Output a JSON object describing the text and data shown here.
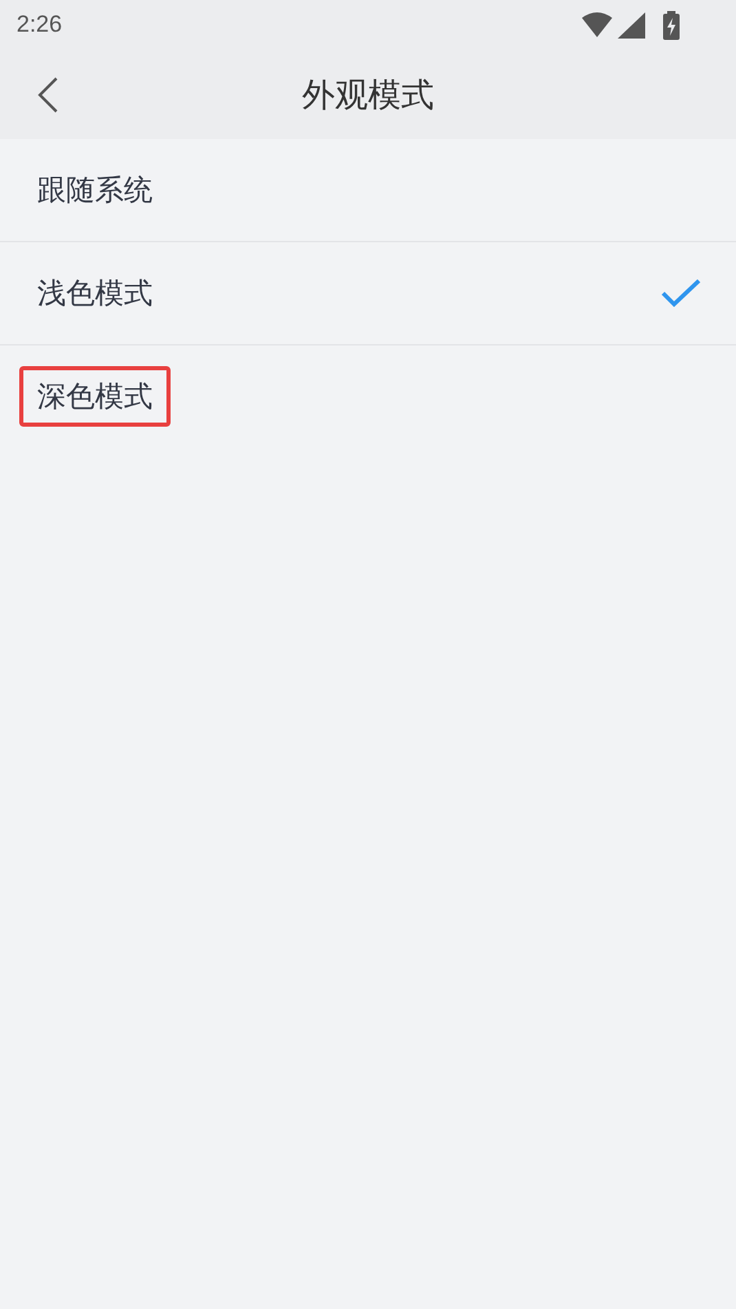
{
  "status_bar": {
    "time": "2:26"
  },
  "header": {
    "title": "外观模式"
  },
  "options": [
    {
      "label": "跟随系统",
      "selected": false,
      "highlighted": false
    },
    {
      "label": "浅色模式",
      "selected": true,
      "highlighted": false
    },
    {
      "label": "深色模式",
      "selected": false,
      "highlighted": true
    }
  ]
}
